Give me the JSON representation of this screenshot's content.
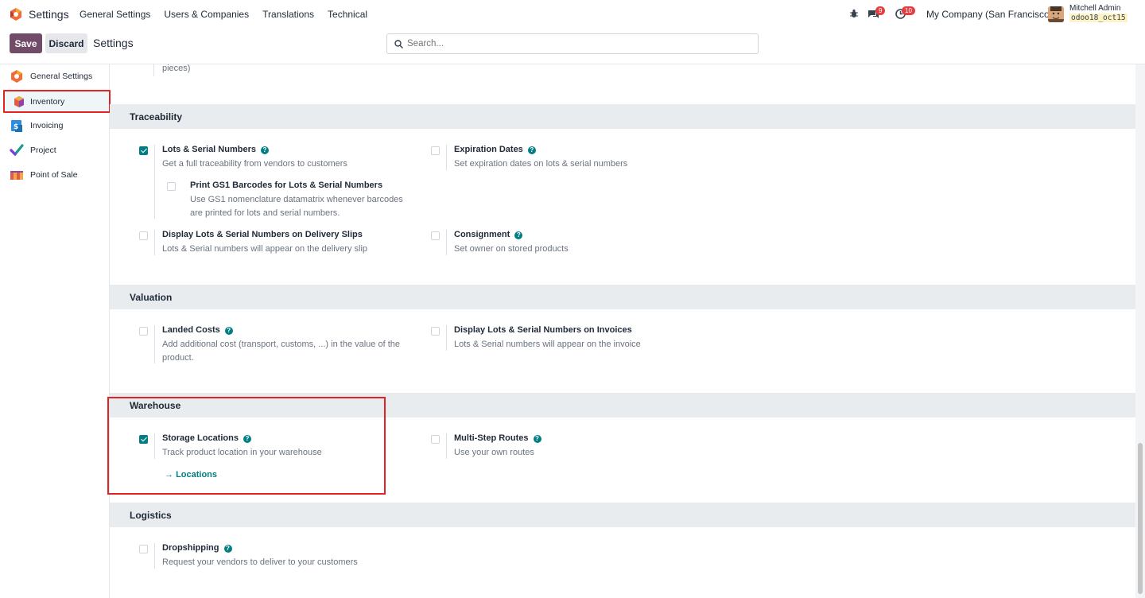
{
  "navbar": {
    "app_name": "Settings",
    "menu": [
      "General Settings",
      "Users & Companies",
      "Translations",
      "Technical"
    ],
    "messages_badge": "9",
    "activities_badge": "10",
    "company": "My Company (San Francisco)",
    "user_name": "Mitchell Admin",
    "db_name": "odoo18_oct15"
  },
  "control": {
    "save_label": "Save",
    "discard_label": "Discard",
    "title": "Settings",
    "search_placeholder": "Search..."
  },
  "sidebar": {
    "items": [
      {
        "label": "General Settings",
        "icon": "odoo-logo-icon"
      },
      {
        "label": "Inventory",
        "icon": "inventory-cube-icon"
      },
      {
        "label": "Invoicing",
        "icon": "invoicing-icon"
      },
      {
        "label": "Project",
        "icon": "project-check-icon"
      },
      {
        "label": "Point of Sale",
        "icon": "pos-shop-icon"
      }
    ]
  },
  "main": {
    "top_fragment": "pieces)",
    "traceability": {
      "title": "Traceability",
      "lots": {
        "title": "Lots & Serial Numbers",
        "desc": "Get a full traceability from vendors to customers",
        "checked": true
      },
      "expiration": {
        "title": "Expiration Dates",
        "desc": "Set expiration dates on lots & serial numbers",
        "checked": false
      },
      "gs1": {
        "title": "Print GS1 Barcodes for Lots & Serial Numbers",
        "desc1": "Use GS1 nomenclature datamatrix whenever barcodes",
        "desc2": "are printed for lots and serial numbers.",
        "checked": false
      },
      "delivery": {
        "title": "Display Lots & Serial Numbers on Delivery Slips",
        "desc": "Lots & Serial numbers will appear on the delivery slip",
        "checked": false
      },
      "consignment": {
        "title": "Consignment",
        "desc": "Set owner on stored products",
        "checked": false
      }
    },
    "valuation": {
      "title": "Valuation",
      "landed": {
        "title": "Landed Costs",
        "desc1": "Add additional cost (transport, customs, ...) in the value of the",
        "desc2": "product.",
        "checked": false
      },
      "invoices": {
        "title": "Display Lots & Serial Numbers on Invoices",
        "desc": "Lots & Serial numbers will appear on the invoice",
        "checked": false
      }
    },
    "warehouse": {
      "title": "Warehouse",
      "storage": {
        "title": "Storage Locations",
        "desc": "Track product location in your warehouse",
        "link": "Locations",
        "checked": true
      },
      "routes": {
        "title": "Multi-Step Routes",
        "desc": "Use your own routes",
        "checked": false
      }
    },
    "logistics": {
      "title": "Logistics",
      "dropship": {
        "title": "Dropshipping",
        "desc": "Request your vendors to deliver to your customers",
        "checked": false
      }
    }
  },
  "colors": {
    "brand": "#714b67",
    "accent": "#017e84",
    "highlight": "#e02424"
  }
}
